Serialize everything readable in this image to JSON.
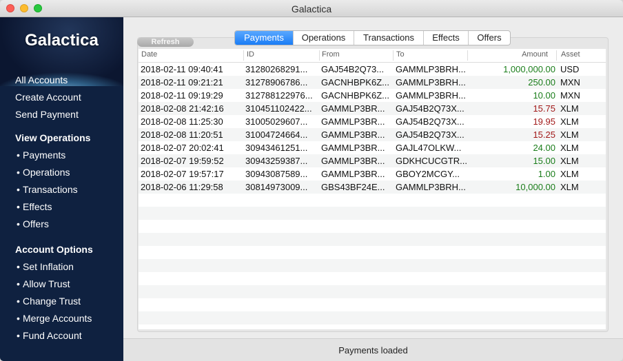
{
  "window": {
    "title": "Galactica"
  },
  "sidebar": {
    "brand": "Galactica",
    "top_items": [
      "All Accounts",
      "Create Account",
      "Send Payment"
    ],
    "view_heading": "View Operations",
    "view_items": [
      "Payments",
      "Operations",
      "Transactions",
      "Effects",
      "Offers"
    ],
    "account_heading": "Account Options",
    "account_items": [
      "Set Inflation",
      "Allow Trust",
      "Change Trust",
      "Merge Accounts",
      "Fund Account"
    ],
    "bullet": "•"
  },
  "toolbar": {
    "refresh_label": "Refresh"
  },
  "tabs": [
    {
      "label": "Payments",
      "active": true
    },
    {
      "label": "Operations",
      "active": false
    },
    {
      "label": "Transactions",
      "active": false
    },
    {
      "label": "Effects",
      "active": false
    },
    {
      "label": "Offers",
      "active": false
    }
  ],
  "table": {
    "columns": [
      "Date",
      "ID",
      "From",
      "To",
      "Amount",
      "Asset"
    ],
    "rows": [
      {
        "date": "2018-02-11 09:40:41",
        "id": "31280268291...",
        "from": "GAJ54B2Q73...",
        "to": "GAMMLP3BRH...",
        "amount": "1,000,000.00",
        "asset": "USD",
        "direction": "in"
      },
      {
        "date": "2018-02-11 09:21:21",
        "id": "31278906786...",
        "from": "GACNHBPK6Z...",
        "to": "GAMMLP3BRH...",
        "amount": "250.00",
        "asset": "MXN",
        "direction": "in"
      },
      {
        "date": "2018-02-11 09:19:29",
        "id": "312788122976...",
        "from": "GACNHBPK6Z...",
        "to": "GAMMLP3BRH...",
        "amount": "10.00",
        "asset": "MXN",
        "direction": "in"
      },
      {
        "date": "2018-02-08 21:42:16",
        "id": "310451102422...",
        "from": "GAMMLP3BR...",
        "to": "GAJ54B2Q73X...",
        "amount": "15.75",
        "asset": "XLM",
        "direction": "out"
      },
      {
        "date": "2018-02-08 11:25:30",
        "id": "31005029607...",
        "from": "GAMMLP3BR...",
        "to": "GAJ54B2Q73X...",
        "amount": "19.95",
        "asset": "XLM",
        "direction": "out"
      },
      {
        "date": "2018-02-08 11:20:51",
        "id": "31004724664...",
        "from": "GAMMLP3BR...",
        "to": "GAJ54B2Q73X...",
        "amount": "15.25",
        "asset": "XLM",
        "direction": "out"
      },
      {
        "date": "2018-02-07 20:02:41",
        "id": "30943461251...",
        "from": "GAMMLP3BR...",
        "to": "GAJL47OLKW...",
        "amount": "24.00",
        "asset": "XLM",
        "direction": "in"
      },
      {
        "date": "2018-02-07 19:59:52",
        "id": "30943259387...",
        "from": "GAMMLP3BR...",
        "to": "GDKHCUCGTR...",
        "amount": "15.00",
        "asset": "XLM",
        "direction": "in"
      },
      {
        "date": "2018-02-07 19:57:17",
        "id": "30943087589...",
        "from": "GAMMLP3BR...",
        "to": "GBOY2MCGY...",
        "amount": "1.00",
        "asset": "XLM",
        "direction": "in"
      },
      {
        "date": "2018-02-06 11:29:58",
        "id": "30814973009...",
        "from": "GBS43BF24E...",
        "to": "GAMMLP3BRH...",
        "amount": "10,000.00",
        "asset": "XLM",
        "direction": "in"
      }
    ],
    "empty_rows": 11
  },
  "status": {
    "text": "Payments loaded"
  },
  "colors": {
    "sidebar_bg": "#0f2140",
    "tab_active": "#1a7cf5",
    "amount_positive": "#1a7d1a",
    "amount_negative": "#a11818"
  }
}
